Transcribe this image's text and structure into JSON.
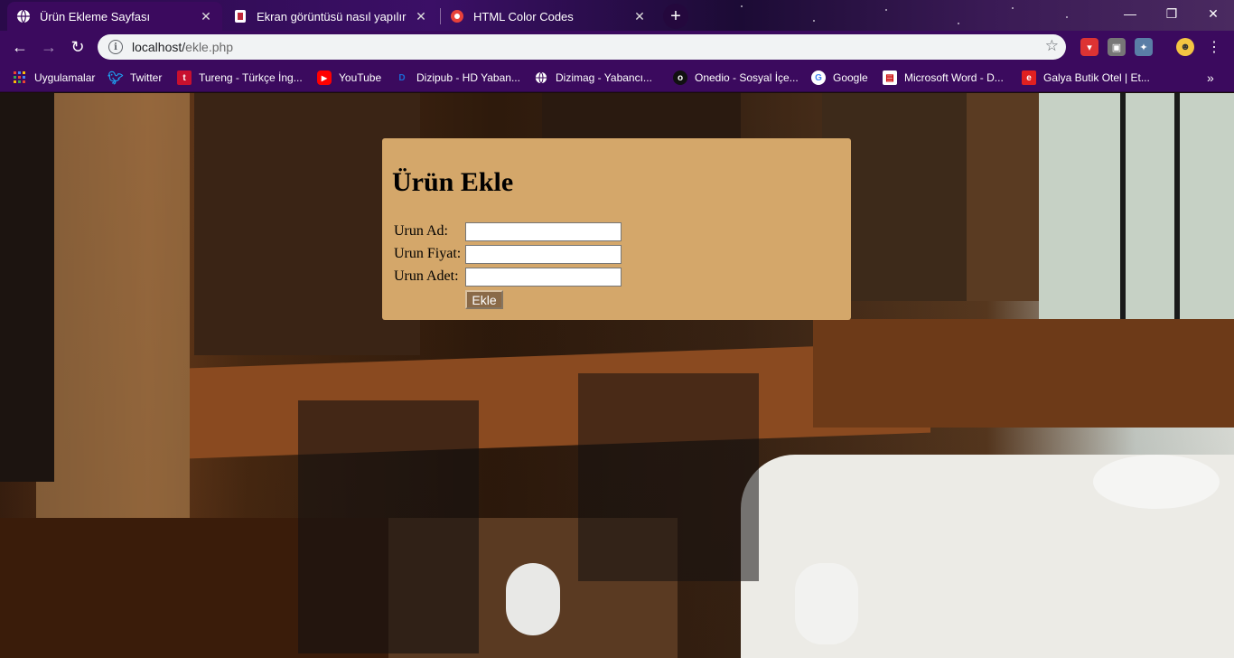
{
  "browser": {
    "tabs": [
      {
        "title": "Ürün Ekleme Sayfası",
        "active": true,
        "icon": "globe-icon"
      },
      {
        "title": "Ekran görüntüsü nasıl yapılır - Ge",
        "active": false,
        "icon": "page-icon"
      },
      {
        "title": "HTML Color Codes",
        "active": false,
        "icon": "color-icon"
      }
    ],
    "new_tab_label": "+",
    "window_controls": {
      "minimize": "—",
      "maximize": "❐",
      "close": "✕"
    },
    "url": {
      "host": "localhost/",
      "path": "ekle.php"
    },
    "bookmarks": [
      {
        "label": "Uygulamalar",
        "icon": "apps-grid-icon"
      },
      {
        "label": "Twitter",
        "icon": "twitter-icon"
      },
      {
        "label": "Tureng - Türkçe İng...",
        "icon": "tureng-icon"
      },
      {
        "label": "YouTube",
        "icon": "youtube-icon"
      },
      {
        "label": "Dizipub - HD Yaban...",
        "icon": "dizipub-icon"
      },
      {
        "label": "Dizimag - Yabancı...",
        "icon": "globe-icon"
      },
      {
        "label": "Onedio - Sosyal İçe...",
        "icon": "onedio-icon"
      },
      {
        "label": "Google",
        "icon": "google-icon"
      },
      {
        "label": "Microsoft Word - D...",
        "icon": "document-icon"
      },
      {
        "label": "Galya Butik Otel | Et...",
        "icon": "galya-icon"
      }
    ],
    "bookmarks_more": "»"
  },
  "form": {
    "heading": "Ürün Ekle",
    "fields": [
      {
        "label": "Urun Ad:",
        "value": ""
      },
      {
        "label": "Urun Fiyat:",
        "value": ""
      },
      {
        "label": "Urun Adet:",
        "value": ""
      }
    ],
    "submit_label": "Ekle"
  },
  "colors": {
    "chrome": "#3b0a5e",
    "form_background": "#d4a76a",
    "submit_button": "#8a6a48"
  }
}
